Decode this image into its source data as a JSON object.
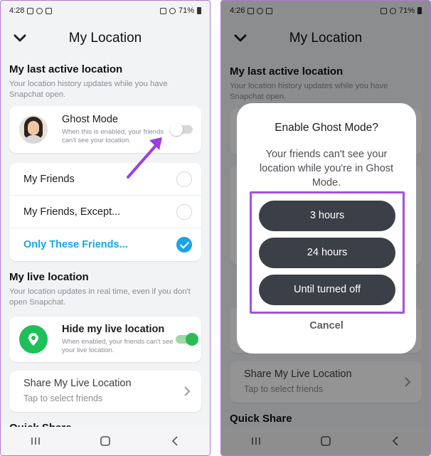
{
  "left": {
    "status": {
      "time": "4:28",
      "battery": "71%"
    },
    "title": "My Location",
    "last_active": {
      "heading": "My last active location",
      "desc": "Your location history updates while you have Snapchat open."
    },
    "ghost_mode": {
      "title": "Ghost Mode",
      "subtitle": "When this is enabled, your friends can't see your location.",
      "enabled": false
    },
    "friend_options": [
      {
        "label": "My Friends",
        "selected": false
      },
      {
        "label": "My Friends, Except...",
        "selected": false
      },
      {
        "label": "Only These Friends...",
        "selected": true
      }
    ],
    "live": {
      "heading": "My live location",
      "desc": "Your location updates in real time, even if you don't open Snapchat.",
      "hide_title": "Hide my live location",
      "hide_subtitle": "When enabled, your friends can't see your live location.",
      "hide_enabled": true,
      "share_title": "Share My Live Location",
      "share_subtitle": "Tap to select friends"
    },
    "quick_share": "Quick Share"
  },
  "right": {
    "status": {
      "time": "4:26",
      "battery": "71%"
    },
    "title": "My Location",
    "last_active_heading": "My last active location",
    "last_active_desc": "Your location history updates while you have Snapchat open.",
    "share_title": "Share My Live Location",
    "share_subtitle": "Tap to select friends",
    "quick_share": "Quick Share",
    "dialog": {
      "title": "Enable Ghost Mode?",
      "body": "Your friends can't see your location while you're in Ghost Mode.",
      "options": [
        "3 hours",
        "24 hours",
        "Until turned off"
      ],
      "cancel": "Cancel"
    }
  },
  "colors": {
    "accent_blue": "#16a6e8",
    "toggle_green": "#2dbb57",
    "highlight_purple": "#a64fe0",
    "dialog_button": "#3b3f47"
  }
}
